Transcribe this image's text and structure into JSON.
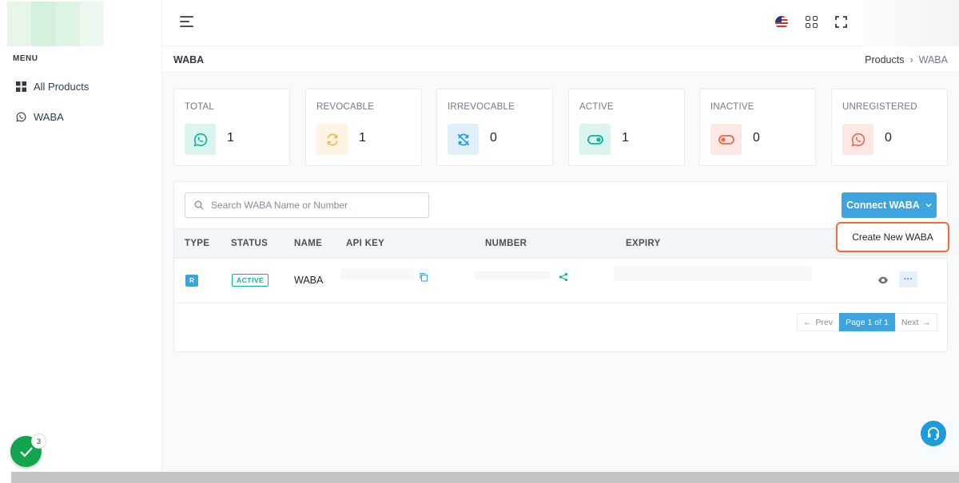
{
  "sidebar": {
    "menu_title": "MENU",
    "items": [
      {
        "label": "All Products",
        "icon": "grid-icon"
      },
      {
        "label": "WABA",
        "icon": "whatsapp-icon"
      }
    ]
  },
  "header": {
    "language": "us-flag-icon"
  },
  "page": {
    "title": "WABA",
    "breadcrumb": [
      "Products",
      "WABA"
    ]
  },
  "stats": [
    {
      "label": "TOTAL",
      "value": "1",
      "icon": "whatsapp-icon",
      "color": "#0ab39c",
      "bg": "#daf4f0"
    },
    {
      "label": "REVOCABLE",
      "value": "1",
      "icon": "refresh-icon",
      "color": "#f7b84b",
      "bg": "#fef4e4"
    },
    {
      "label": "IRREVOCABLE",
      "value": "0",
      "icon": "refresh-off-icon",
      "color": "#299cdb",
      "bg": "#dff0fa"
    },
    {
      "label": "ACTIVE",
      "value": "1",
      "icon": "toggle-on-icon",
      "color": "#0ab39c",
      "bg": "#daf4f0"
    },
    {
      "label": "INACTIVE",
      "value": "0",
      "icon": "toggle-off-icon",
      "color": "#f06548",
      "bg": "#fde8e4"
    },
    {
      "label": "UNREGISTERED",
      "value": "0",
      "icon": "whatsapp-icon",
      "color": "#f06548",
      "bg": "#fde8e4"
    }
  ],
  "search": {
    "placeholder": "Search WABA Name or Number"
  },
  "connect_button": "Connect WABA",
  "dropdown": {
    "items": [
      "Create New WABA"
    ]
  },
  "table": {
    "columns": [
      "TYPE",
      "STATUS",
      "NAME",
      "API KEY",
      "NUMBER",
      "EXPIRY"
    ],
    "rows": [
      {
        "type": "R",
        "status": "ACTIVE",
        "name": "WABA"
      }
    ]
  },
  "pagination": {
    "prev": "Prev",
    "current": "Page 1 of 1",
    "next": "Next"
  },
  "notifications": {
    "count": "3"
  },
  "colors": {
    "primary": "#3ea4e0",
    "success": "#0ab39c",
    "highlight": "#f26b3a"
  }
}
